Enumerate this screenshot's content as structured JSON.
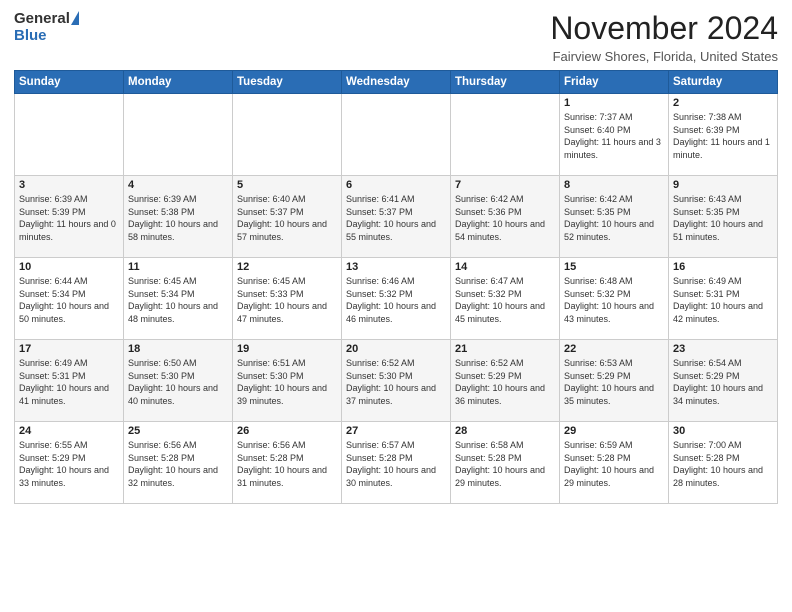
{
  "logo": {
    "general": "General",
    "blue": "Blue"
  },
  "header": {
    "month": "November 2024",
    "location": "Fairview Shores, Florida, United States"
  },
  "weekdays": [
    "Sunday",
    "Monday",
    "Tuesday",
    "Wednesday",
    "Thursday",
    "Friday",
    "Saturday"
  ],
  "weeks": [
    [
      {
        "day": "",
        "info": ""
      },
      {
        "day": "",
        "info": ""
      },
      {
        "day": "",
        "info": ""
      },
      {
        "day": "",
        "info": ""
      },
      {
        "day": "",
        "info": ""
      },
      {
        "day": "1",
        "info": "Sunrise: 7:37 AM\nSunset: 6:40 PM\nDaylight: 11 hours and 3 minutes."
      },
      {
        "day": "2",
        "info": "Sunrise: 7:38 AM\nSunset: 6:39 PM\nDaylight: 11 hours and 1 minute."
      }
    ],
    [
      {
        "day": "3",
        "info": "Sunrise: 6:39 AM\nSunset: 5:39 PM\nDaylight: 11 hours and 0 minutes."
      },
      {
        "day": "4",
        "info": "Sunrise: 6:39 AM\nSunset: 5:38 PM\nDaylight: 10 hours and 58 minutes."
      },
      {
        "day": "5",
        "info": "Sunrise: 6:40 AM\nSunset: 5:37 PM\nDaylight: 10 hours and 57 minutes."
      },
      {
        "day": "6",
        "info": "Sunrise: 6:41 AM\nSunset: 5:37 PM\nDaylight: 10 hours and 55 minutes."
      },
      {
        "day": "7",
        "info": "Sunrise: 6:42 AM\nSunset: 5:36 PM\nDaylight: 10 hours and 54 minutes."
      },
      {
        "day": "8",
        "info": "Sunrise: 6:42 AM\nSunset: 5:35 PM\nDaylight: 10 hours and 52 minutes."
      },
      {
        "day": "9",
        "info": "Sunrise: 6:43 AM\nSunset: 5:35 PM\nDaylight: 10 hours and 51 minutes."
      }
    ],
    [
      {
        "day": "10",
        "info": "Sunrise: 6:44 AM\nSunset: 5:34 PM\nDaylight: 10 hours and 50 minutes."
      },
      {
        "day": "11",
        "info": "Sunrise: 6:45 AM\nSunset: 5:34 PM\nDaylight: 10 hours and 48 minutes."
      },
      {
        "day": "12",
        "info": "Sunrise: 6:45 AM\nSunset: 5:33 PM\nDaylight: 10 hours and 47 minutes."
      },
      {
        "day": "13",
        "info": "Sunrise: 6:46 AM\nSunset: 5:32 PM\nDaylight: 10 hours and 46 minutes."
      },
      {
        "day": "14",
        "info": "Sunrise: 6:47 AM\nSunset: 5:32 PM\nDaylight: 10 hours and 45 minutes."
      },
      {
        "day": "15",
        "info": "Sunrise: 6:48 AM\nSunset: 5:32 PM\nDaylight: 10 hours and 43 minutes."
      },
      {
        "day": "16",
        "info": "Sunrise: 6:49 AM\nSunset: 5:31 PM\nDaylight: 10 hours and 42 minutes."
      }
    ],
    [
      {
        "day": "17",
        "info": "Sunrise: 6:49 AM\nSunset: 5:31 PM\nDaylight: 10 hours and 41 minutes."
      },
      {
        "day": "18",
        "info": "Sunrise: 6:50 AM\nSunset: 5:30 PM\nDaylight: 10 hours and 40 minutes."
      },
      {
        "day": "19",
        "info": "Sunrise: 6:51 AM\nSunset: 5:30 PM\nDaylight: 10 hours and 39 minutes."
      },
      {
        "day": "20",
        "info": "Sunrise: 6:52 AM\nSunset: 5:30 PM\nDaylight: 10 hours and 37 minutes."
      },
      {
        "day": "21",
        "info": "Sunrise: 6:52 AM\nSunset: 5:29 PM\nDaylight: 10 hours and 36 minutes."
      },
      {
        "day": "22",
        "info": "Sunrise: 6:53 AM\nSunset: 5:29 PM\nDaylight: 10 hours and 35 minutes."
      },
      {
        "day": "23",
        "info": "Sunrise: 6:54 AM\nSunset: 5:29 PM\nDaylight: 10 hours and 34 minutes."
      }
    ],
    [
      {
        "day": "24",
        "info": "Sunrise: 6:55 AM\nSunset: 5:29 PM\nDaylight: 10 hours and 33 minutes."
      },
      {
        "day": "25",
        "info": "Sunrise: 6:56 AM\nSunset: 5:28 PM\nDaylight: 10 hours and 32 minutes."
      },
      {
        "day": "26",
        "info": "Sunrise: 6:56 AM\nSunset: 5:28 PM\nDaylight: 10 hours and 31 minutes."
      },
      {
        "day": "27",
        "info": "Sunrise: 6:57 AM\nSunset: 5:28 PM\nDaylight: 10 hours and 30 minutes."
      },
      {
        "day": "28",
        "info": "Sunrise: 6:58 AM\nSunset: 5:28 PM\nDaylight: 10 hours and 29 minutes."
      },
      {
        "day": "29",
        "info": "Sunrise: 6:59 AM\nSunset: 5:28 PM\nDaylight: 10 hours and 29 minutes."
      },
      {
        "day": "30",
        "info": "Sunrise: 7:00 AM\nSunset: 5:28 PM\nDaylight: 10 hours and 28 minutes."
      }
    ]
  ]
}
